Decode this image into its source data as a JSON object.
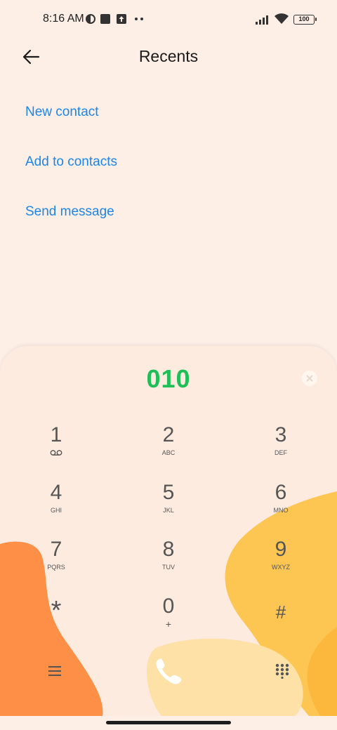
{
  "status_bar": {
    "time": "8:16 AM",
    "battery": "100"
  },
  "header": {
    "title": "Recents"
  },
  "actions": [
    {
      "label": "New contact"
    },
    {
      "label": "Add to contacts"
    },
    {
      "label": "Send message"
    }
  ],
  "dialer": {
    "number": "010",
    "keys": [
      {
        "digit": "1",
        "letters": ""
      },
      {
        "digit": "2",
        "letters": "ABC"
      },
      {
        "digit": "3",
        "letters": "DEF"
      },
      {
        "digit": "4",
        "letters": "GHI"
      },
      {
        "digit": "5",
        "letters": "JKL"
      },
      {
        "digit": "6",
        "letters": "MNO"
      },
      {
        "digit": "7",
        "letters": "PQRS"
      },
      {
        "digit": "8",
        "letters": "TUV"
      },
      {
        "digit": "9",
        "letters": "WXYZ"
      },
      {
        "digit": "*",
        "letters": ""
      },
      {
        "digit": "0",
        "letters": "+"
      },
      {
        "digit": "#",
        "letters": ""
      }
    ]
  },
  "colors": {
    "accent_link": "#1c86e8",
    "number": "#1fbf57",
    "blob_orange": "#fe8f47",
    "blob_yellow": "#fdc552"
  }
}
